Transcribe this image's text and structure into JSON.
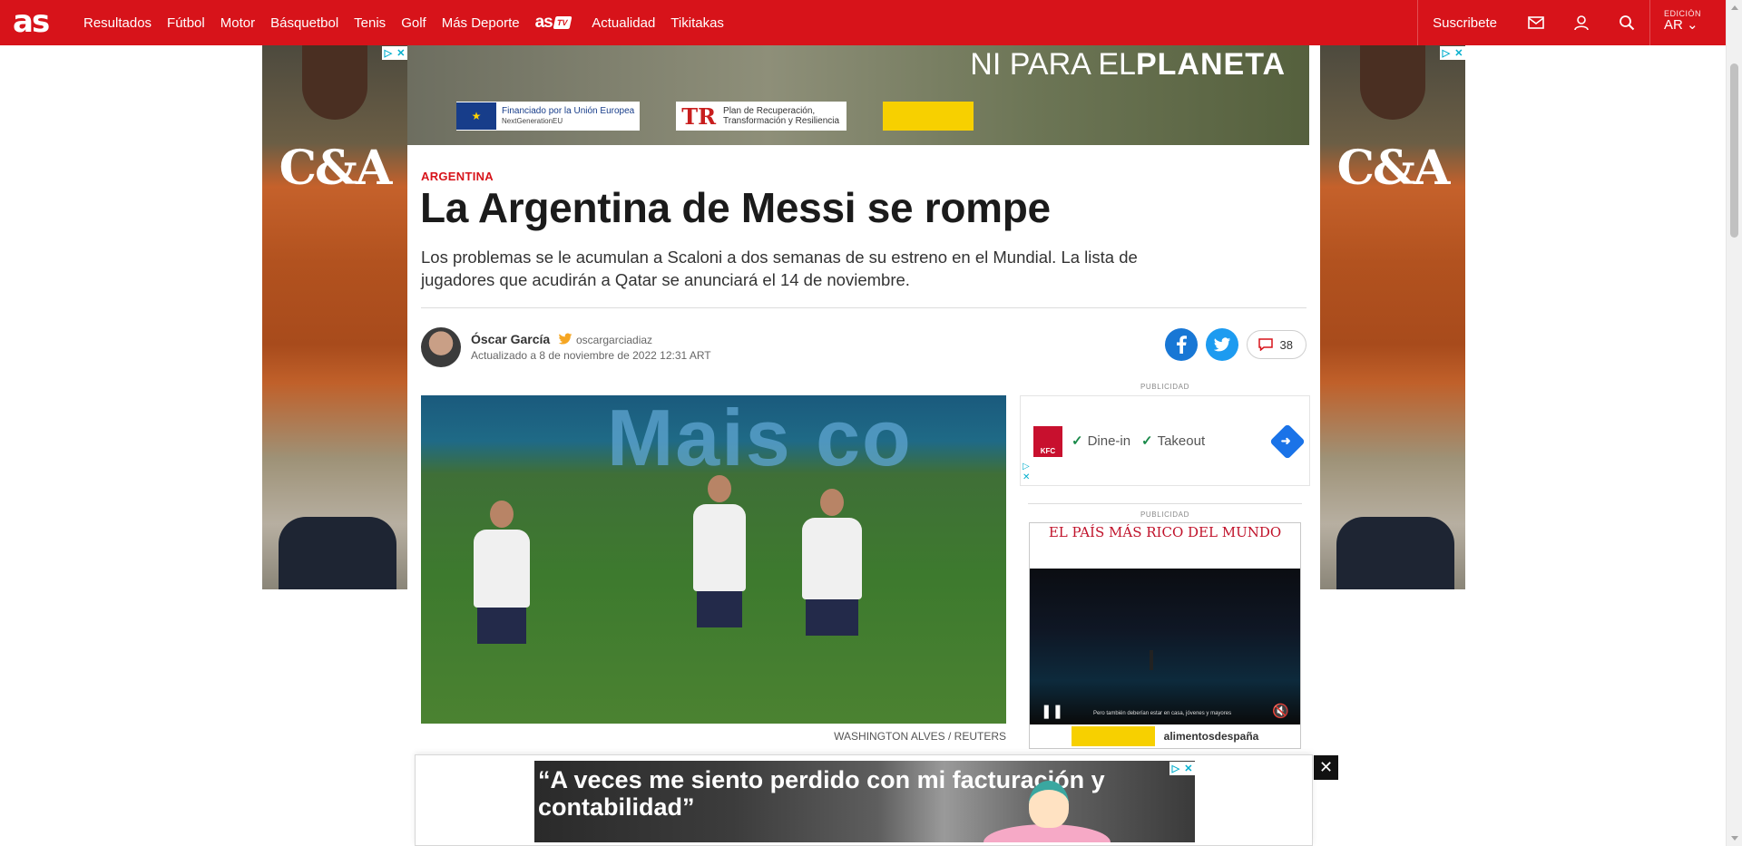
{
  "site": {
    "logo": "as",
    "brand_color": "#d7131a"
  },
  "nav": {
    "items": [
      "Resultados",
      "Fútbol",
      "Motor",
      "Básquetbol",
      "Tenis",
      "Golf",
      "Más Deporte"
    ],
    "astv_label": "as",
    "astv_badge": "TV",
    "items_after": [
      "Actualidad",
      "Tikitakas"
    ],
    "subscribe": "Suscribete",
    "edition_label": "EDICIÓN",
    "edition_value": "AR"
  },
  "ads": {
    "side_brand": "C&A",
    "top_banner_slogan_light": "NI PARA EL",
    "top_banner_slogan_bold": "PLANETA",
    "top_banner_eu": "Financiado por la Unión Europea",
    "top_banner_eu_sub": "NextGenerationEU",
    "top_banner_plan": "Plan de Recuperación, Transformación y Resiliencia",
    "publicidad": "PUBLICIDAD",
    "kfc_brand": "KFC",
    "kfc_options": [
      "Dine-in",
      "Takeout"
    ],
    "pais_title": "El país más rico del mundo",
    "pais_caption": "Pero también deberían estar en casa, jóvenes y mayores",
    "pais_footer": "alimentosdespaña",
    "sticky_quote": "“A veces me siento perdido con mi facturación y contabilidad”"
  },
  "article": {
    "section": "ARGENTINA",
    "headline": "La Argentina de Messi se rompe",
    "subhead": "Los problemas se le acumulan a Scaloni a dos semanas de su estreno en el Mundial. La lista de jugadores que acudirán a Qatar se anunciará el 14 de noviembre.",
    "author": "Óscar García",
    "twitter_handle": "oscargarciadiaz",
    "updated": "Actualizado a 8 de noviembre de 2022 12:31 ART",
    "comments_count": "38",
    "photo_watermark": "Mais co",
    "photo_credit": "WASHINGTON ALVES / REUTERS"
  }
}
